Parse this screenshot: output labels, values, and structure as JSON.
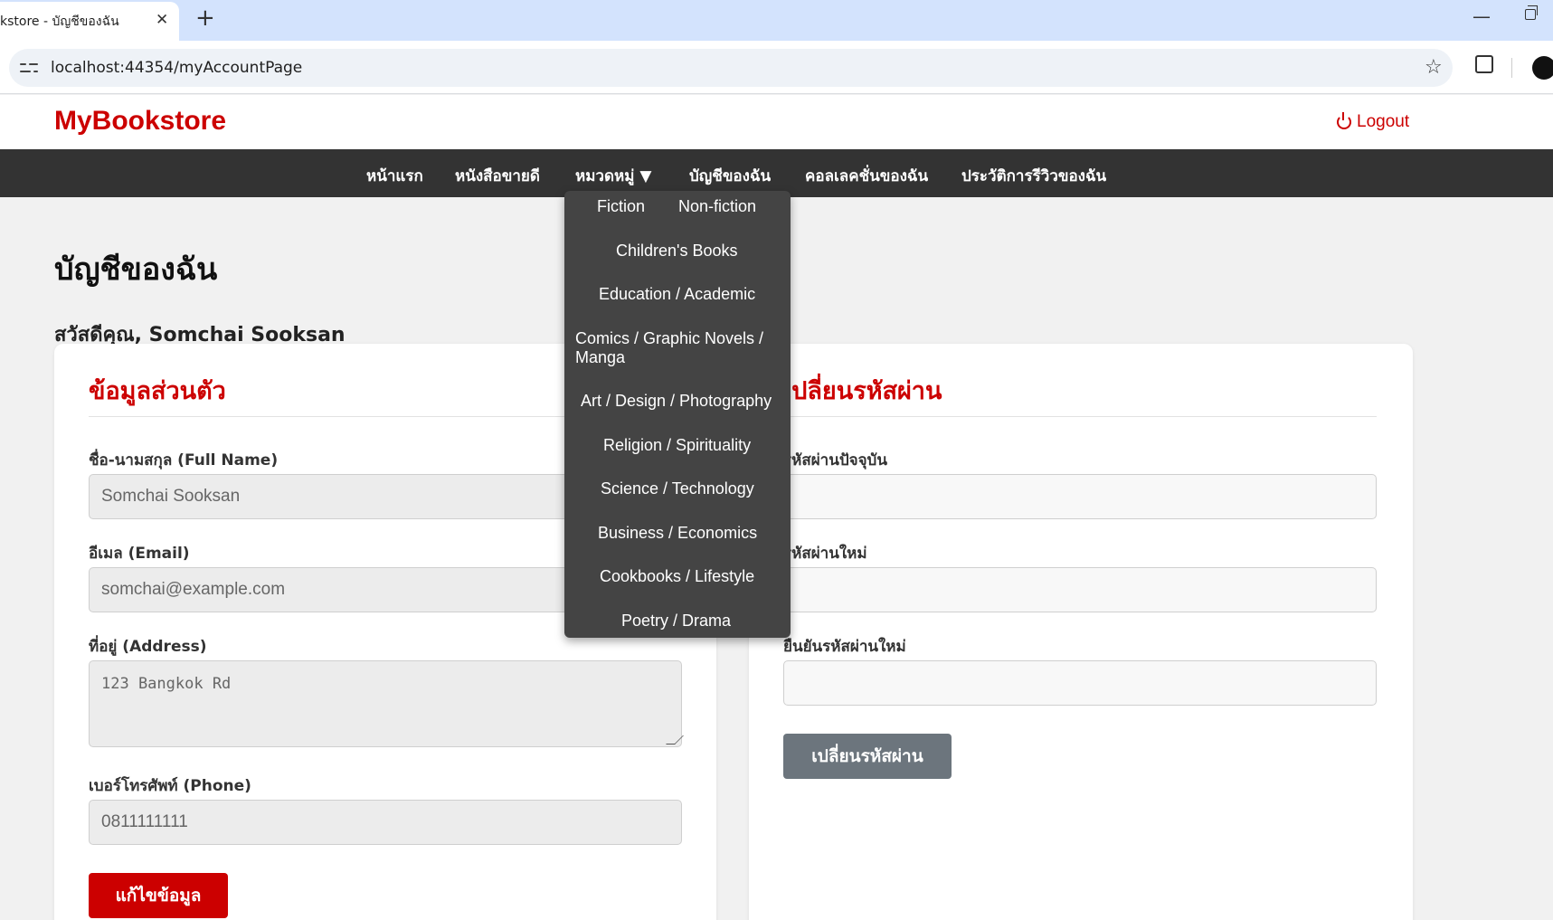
{
  "browser": {
    "tab_title": "kstore - บัญชีของฉัน",
    "url": "localhost:44354/myAccountPage"
  },
  "site": {
    "logo": "MyBookstore",
    "logout_label": "Logout",
    "nav": [
      "หน้าแรก",
      "หนังสือขายดี",
      "หมวดหมู่ ▼",
      "บัญชีของฉัน",
      "คอลเลคชั่นของฉัน",
      "ประวัติการรีวิวของฉัน"
    ],
    "categories": [
      "Fiction",
      "Non-fiction",
      "Children's Books",
      "Education / Academic",
      "Comics / Graphic Novels /",
      "Manga",
      "Art / Design / Photography",
      "Religion / Spirituality",
      "Science / Technology",
      "Business / Economics",
      "Cookbooks / Lifestyle",
      "Poetry / Drama"
    ]
  },
  "page": {
    "title": "บัญชีของฉัน",
    "greeting": "สวัสดีคุณ, Somchai Sooksan"
  },
  "profile": {
    "title": "ข้อมูลส่วนตัว",
    "fullname_label": "ชื่อ-นามสกุล (Full Name)",
    "fullname_value": "Somchai Sooksan",
    "email_label": "อีเมล (Email)",
    "email_value": "somchai@example.com",
    "address_label": "ที่อยู่ (Address)",
    "address_value": "123 Bangkok Rd",
    "phone_label": "เบอร์โทรศัพท์ (Phone)",
    "phone_value": "0811111111",
    "edit_button": "แก้ไขข้อมูล"
  },
  "password": {
    "title": "เปลี่ยนรหัสผ่าน",
    "current_label": "รหัสผ่านปัจจุบัน",
    "new_label": "รหัสผ่านใหม่",
    "confirm_label": "ยืนยันรหัสผ่านใหม่",
    "change_button": "เปลี่ยนรหัสผ่าน"
  },
  "colors": {
    "brand": "#cc0000",
    "navbar": "#333333",
    "dropdown": "#444444",
    "secondary_button": "#6c757d"
  }
}
